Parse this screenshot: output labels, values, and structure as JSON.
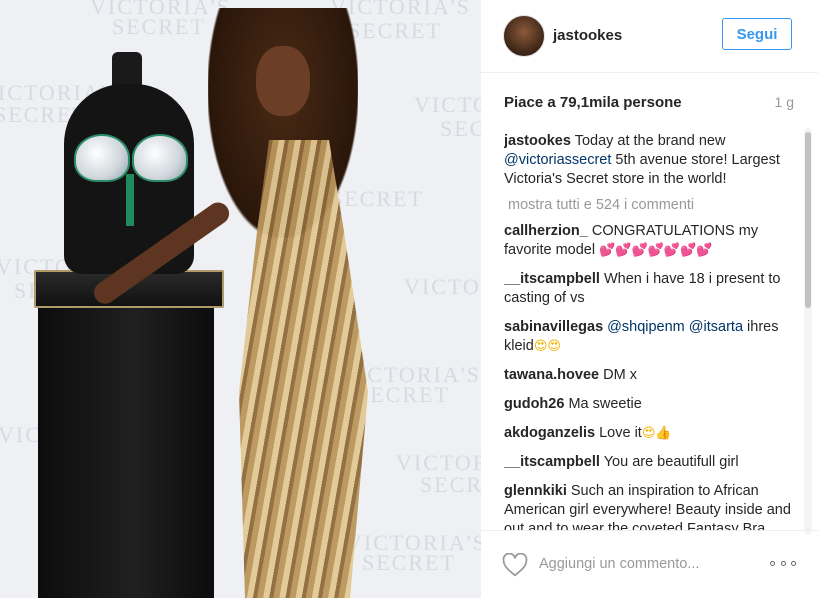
{
  "post": {
    "username": "jastookes",
    "follow_label": "Segui",
    "likes": "Piace a 79,1mila persone",
    "time": "1 g",
    "caption": {
      "user": "jastookes",
      "text_before": "Today at the brand new",
      "mention": "@victoriassecret",
      "text_after": "5th avenue store! Largest Victoria's Secret store in the world!"
    },
    "view_all": "mostra tutti e 524 i commenti",
    "comments": [
      {
        "user": "callherzion_",
        "text": "CONGRATULATIONS my favorite model",
        "emoji": "💕💕💕💕💕💕💕"
      },
      {
        "user": "__itscampbell",
        "text": "When i have 18 i present to casting of vs"
      },
      {
        "user": "sabinavillegas",
        "mention1": "@shqipenm",
        "mention2": "@itsarta",
        "text": "ihres kleid",
        "emoji": "😍😍"
      },
      {
        "user": "tawana.hovee",
        "text": "DM x"
      },
      {
        "user": "gudoh26",
        "text": "Ma sweetie"
      },
      {
        "user": "akdoganzelis",
        "text": "Love it",
        "emoji": "😍👍"
      },
      {
        "user": "__itscampbell",
        "text": "You are beautifull girl"
      },
      {
        "user": "glennkiki",
        "text": "Such an inspiration to African American girl everywhere! Beauty inside and out and to wear the coveted Fantasy Bra congrats!"
      }
    ],
    "comment_placeholder": "Aggiungi un commento..."
  },
  "photo": {
    "watermark_text": [
      "VICTORIA'S",
      "SECRET"
    ]
  },
  "colors": {
    "accent": "#3897f0",
    "mention": "#003569",
    "muted": "#999999"
  },
  "icons": {
    "like": "heart-outline-icon",
    "more": "ellipsis-icon"
  }
}
